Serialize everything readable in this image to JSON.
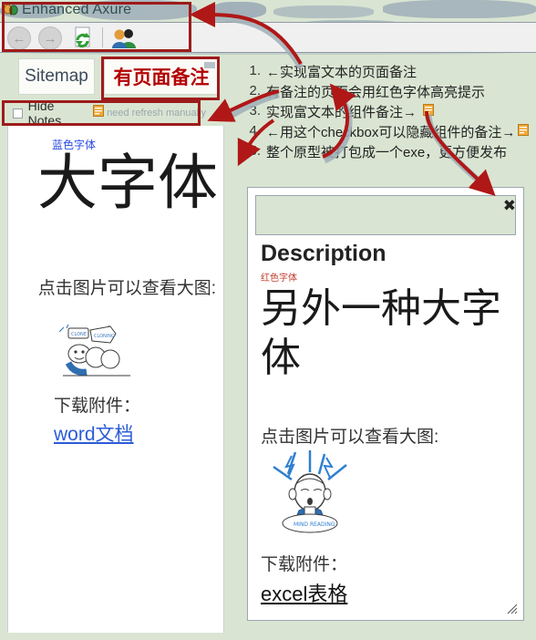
{
  "window": {
    "title": "Enhanced Axure",
    "app_icon": "butterfly-icon"
  },
  "toolbar": {
    "back_label": "←",
    "forward_label": "→",
    "refresh_name": "refresh-icon",
    "users_name": "users-icon"
  },
  "tabs": [
    {
      "id": "sitemap",
      "label": "Sitemap"
    },
    {
      "id": "page-notes",
      "label": "有页面备注"
    }
  ],
  "notes_bar": {
    "checkbox_label": "Hide Notes",
    "checkbox_checked": false,
    "hint": "need refresh manually",
    "note_icon": "note-icon"
  },
  "left_panel": {
    "blue_small": "蓝色字体",
    "big_text": "大字体",
    "mid_text": "点击图片可以查看大图:",
    "download_label": "下载附件：",
    "link_label": "word文档",
    "image_name": "sketch-worm-illustration"
  },
  "popup": {
    "close_label": "✖",
    "title": "Description",
    "red_small": "红色字体",
    "big_text": "另外一种大字体",
    "mid_text": "点击图片可以查看大图:",
    "download_label": "下载附件：",
    "link_label": "excel表格",
    "image_name": "mind-reading-illustration"
  },
  "note_list": [
    {
      "num": "1.",
      "text": "←实现富文本的页面备注"
    },
    {
      "num": "2.",
      "text": "有备注的页面会用红色字体高亮提示"
    },
    {
      "num": "3.",
      "text": "实现富文本的组件备注→"
    },
    {
      "num": "4.",
      "text": "←用这个checkbox可以隐藏组件的备注→"
    },
    {
      "num": "5.",
      "text": "整个原型被打包成一个exe，更方便发布"
    }
  ],
  "colors": {
    "desktop": "#d9e5d2",
    "annotation_red": "#9e1b1b",
    "tab_notes_red": "#b40000",
    "blue_text": "#2b4ae0",
    "link_blue": "#2b5bd7",
    "red_small": "#c0392b",
    "toolbar_bg": "#f0f0f0"
  }
}
